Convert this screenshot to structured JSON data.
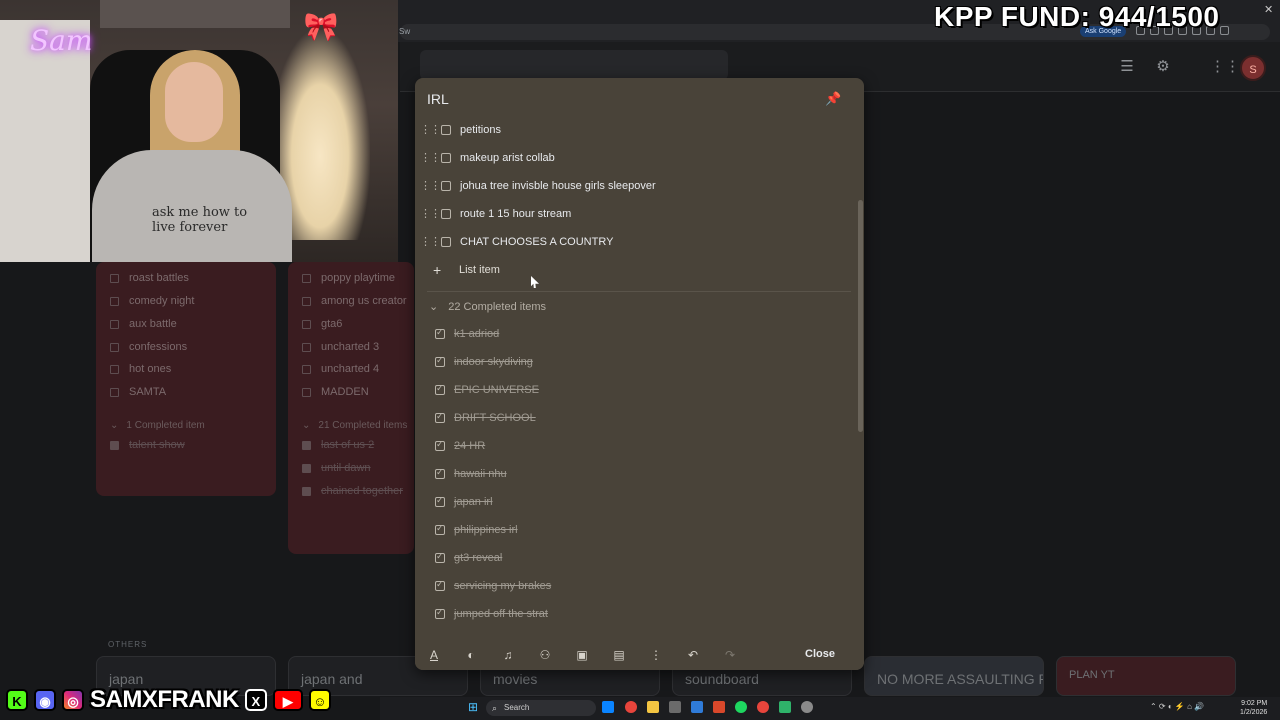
{
  "browser": {
    "url_fragment": "Sw",
    "ask_google_label": "Ask Google",
    "close_glyph": "✕"
  },
  "keep": {
    "avatar_letter": "S"
  },
  "modal": {
    "title": "IRL",
    "items": [
      {
        "label": "petitions",
        "checked": false
      },
      {
        "label": "makeup arist collab",
        "checked": false
      },
      {
        "label": "johua tree invisble house girls sleepover",
        "checked": false
      },
      {
        "label": "route 1 15 hour stream",
        "checked": false
      },
      {
        "label": "CHAT CHOOSES A COUNTRY",
        "checked": false
      }
    ],
    "add_item_label": "List item",
    "completed_header": "22 Completed items",
    "completed": [
      {
        "label": "k1 adriod"
      },
      {
        "label": "indoor skydiving"
      },
      {
        "label": "EPIC UNIVERSE"
      },
      {
        "label": "DRIFT SCHOOL"
      },
      {
        "label": "24 HR"
      },
      {
        "label": "hawaii nhu"
      },
      {
        "label": "japan irl"
      },
      {
        "label": "philippines irl"
      },
      {
        "label": "gt3 reveal"
      },
      {
        "label": "servicing my brakes"
      },
      {
        "label": "jumped off the strat"
      }
    ],
    "close_label": "Close",
    "toolbar_icons": [
      "text-format-icon",
      "palette-icon",
      "reminder-bell-icon",
      "collaborator-icon",
      "image-icon",
      "archive-icon",
      "more-vert-icon",
      "undo-icon",
      "redo-icon"
    ]
  },
  "background_notes": {
    "note_a": {
      "items": [
        "roast battles",
        "comedy night",
        "aux battle",
        "confessions",
        "hot ones",
        "SAMTA"
      ],
      "completed_header": "1 Completed item",
      "completed": [
        "talent show"
      ]
    },
    "note_b": {
      "items": [
        "poppy playtime",
        "among us creator",
        "gta6",
        "uncharted 3",
        "uncharted 4",
        "MADDEN"
      ],
      "completed_header": "21 Completed items",
      "completed": [
        "last of us 2",
        "until dawn",
        "chained together"
      ]
    },
    "others_label": "OTHERS",
    "bottom_cards": [
      "japan",
      "japan and",
      "movies",
      "soundboard",
      "NO MORE ASSAULTING PEOPLE",
      "PLAN YT"
    ]
  },
  "overlay": {
    "fund_text": "KPP FUND: 944/1500",
    "handle": "SAMXFRANK",
    "webcam_sign": "Sam",
    "hoodie_text": "ask me how to live forever"
  },
  "taskbar": {
    "search_placeholder": "Search",
    "time": "9:02 PM",
    "date": "1/2/2026"
  },
  "colors": {
    "modal_bg": "#494339",
    "bg_note": "#3a1c20",
    "page_bg": "#17181a"
  }
}
